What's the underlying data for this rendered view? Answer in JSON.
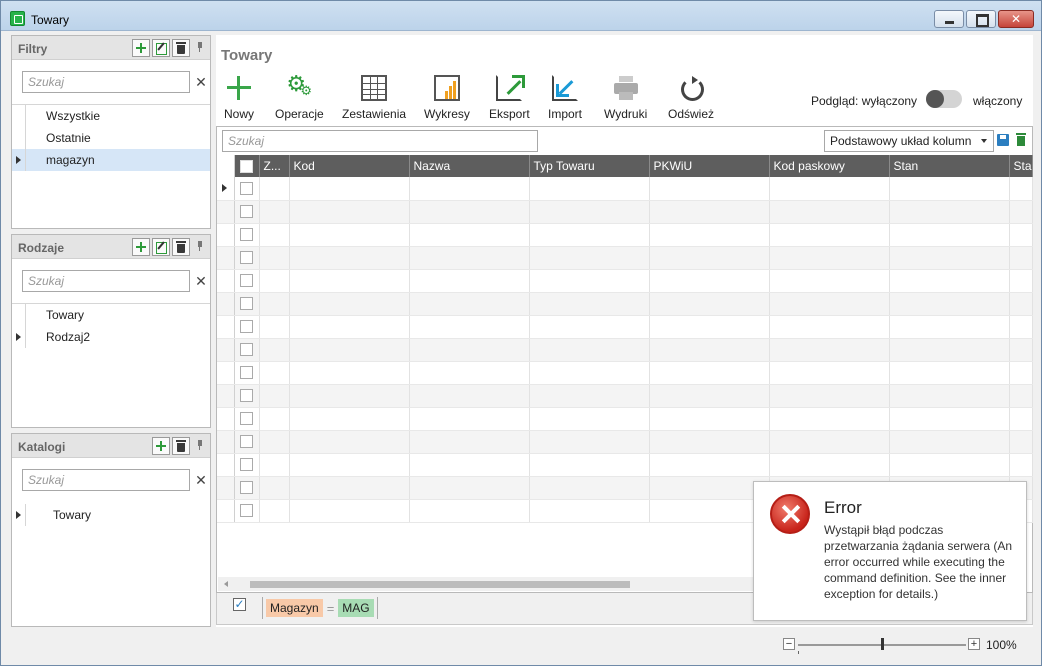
{
  "window": {
    "title": "Towary"
  },
  "panels": {
    "filtry": {
      "title": "Filtry",
      "search_placeholder": "Szukaj",
      "items": [
        {
          "label": "Wszystkie"
        },
        {
          "label": "Ostatnie"
        },
        {
          "label": "magazyn"
        }
      ]
    },
    "rodzaje": {
      "title": "Rodzaje",
      "search_placeholder": "Szukaj",
      "items": [
        {
          "label": "Towary"
        },
        {
          "label": "Rodzaj2"
        }
      ]
    },
    "katalogi": {
      "title": "Katalogi",
      "search_placeholder": "Szukaj",
      "items": [
        {
          "label": "Towary"
        }
      ]
    }
  },
  "main": {
    "title": "Towary",
    "toolbar": {
      "nowy": "Nowy",
      "operacje": "Operacje",
      "zestawienia": "Zestawienia",
      "wykresy": "Wykresy",
      "eksport": "Eksport",
      "import": "Import",
      "wydruki": "Wydruki",
      "odswiez": "Odśwież"
    },
    "preview": {
      "off_label": "Podgląd: wyłączony",
      "on_label": "włączony"
    },
    "grid": {
      "search_placeholder": "Szukaj",
      "layout": "Podstawowy układ kolumn",
      "columns": [
        "Z...",
        "Kod",
        "Nazwa",
        "Typ Towaru",
        "PKWiU",
        "Kod paskowy",
        "Stan",
        "Stan"
      ]
    },
    "filter_expression": {
      "field": "Magazyn",
      "operator": "=",
      "value": "MAG"
    }
  },
  "toast": {
    "title": "Error",
    "message": "Wystąpił błąd podczas przetwarzania żądania serwera (An error occurred while executing the command definition. See the inner exception for details.)"
  },
  "status": {
    "zoom": "100%"
  }
}
